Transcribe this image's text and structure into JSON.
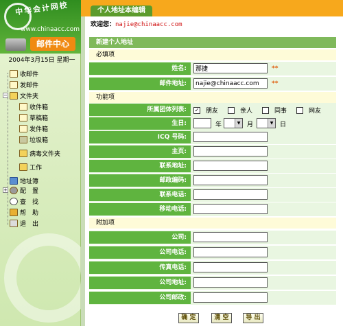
{
  "brand": {
    "site_name_cn": "中华会计网校",
    "site_url": "www.chinaacc.com",
    "mail_center": "邮件中心"
  },
  "sidebar": {
    "date": "2004年3月15日 星期一",
    "items": [
      {
        "label": "收邮件",
        "icon": "receive-mail-icon"
      },
      {
        "label": "发邮件",
        "icon": "send-mail-icon"
      },
      {
        "label": "文件夹",
        "icon": "folder-icon"
      },
      {
        "label": "收件箱",
        "icon": "inbox-icon"
      },
      {
        "label": "草稿箱",
        "icon": "drafts-icon"
      },
      {
        "label": "发件箱",
        "icon": "outbox-icon"
      },
      {
        "label": "垃圾箱",
        "icon": "trash-icon"
      },
      {
        "label": "病毒文件夹",
        "icon": "virus-folder-icon"
      },
      {
        "label": "工作",
        "icon": "work-folder-icon"
      },
      {
        "label": "地址簿",
        "icon": "address-book-icon"
      },
      {
        "label": "配　置",
        "icon": "settings-icon"
      },
      {
        "label": "查　找",
        "icon": "search-icon"
      },
      {
        "label": "帮　助",
        "icon": "help-icon"
      },
      {
        "label": "退　出",
        "icon": "exit-icon"
      }
    ]
  },
  "header": {
    "tab_title": "个人地址本编辑",
    "welcome_prefix": "欢迎您：",
    "user_email": "najie@chinaacc.com"
  },
  "form": {
    "panel_title": "新建个人地址",
    "section_required": "必填项",
    "section_function": "功能项",
    "section_extra": "附加项",
    "name_label": "姓名:",
    "name_value": "那捷",
    "email_label": "邮件地址:",
    "email_value": "najie@chinaacc.com",
    "required_mark": "**",
    "group_label": "所属团体列表:",
    "groups": [
      {
        "label": "朋友",
        "checked": true
      },
      {
        "label": "亲人",
        "checked": false
      },
      {
        "label": "同事",
        "checked": false
      },
      {
        "label": "网友",
        "checked": false
      }
    ],
    "birthday_label": "生日:",
    "year_unit": "年",
    "month_unit": "月",
    "day_unit": "日",
    "icq_label": "ICQ 号码:",
    "homepage_label": "主页:",
    "contact_address_label": "联系地址:",
    "postcode_label": "邮政编码:",
    "contact_phone_label": "联系电话:",
    "mobile_label": "移动电话:",
    "company_label": "公司:",
    "company_phone_label": "公司电话:",
    "fax_label": "传真电话:",
    "company_address_label": "公司地址:",
    "company_postcode_label": "公司邮政:"
  },
  "buttons": {
    "ok": "确 定",
    "clear": "清 空",
    "export": "导 出"
  }
}
